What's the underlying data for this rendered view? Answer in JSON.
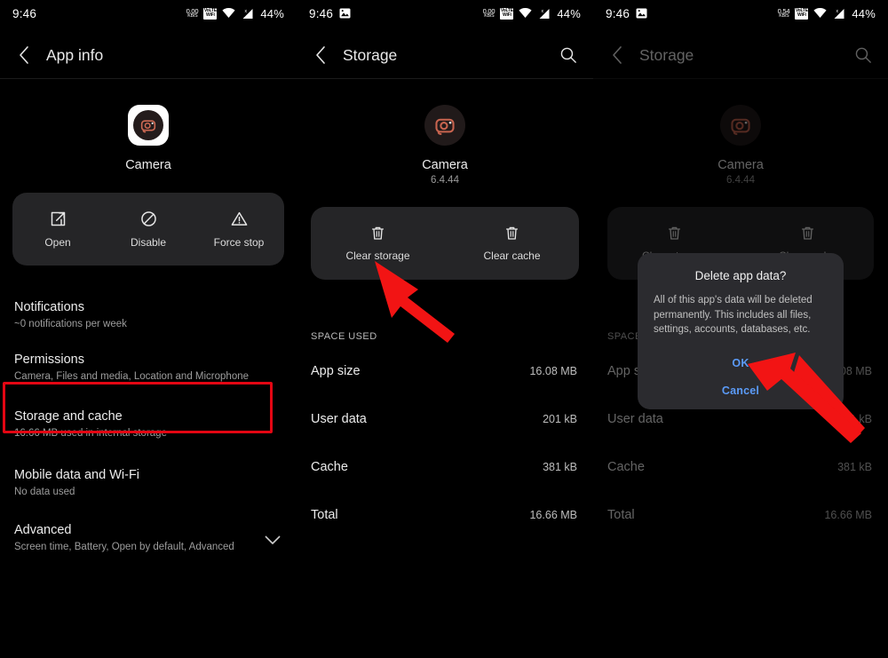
{
  "status_bar": {
    "time": "9:46",
    "data_rate_value": "0.00",
    "data_rate_unit": "KB/S",
    "data_rate_value_3": "0.54",
    "data_rate_unit_3": "KB/S",
    "vowifi_top": "VoLTE",
    "vowifi_bottom": "WiFi",
    "battery": "44%",
    "icons": [
      "image-icon",
      "data-rate-icon",
      "vowifi-icon",
      "wifi-icon",
      "cellular-signal-icon"
    ]
  },
  "panel1": {
    "appbar": {
      "title": "App info",
      "back_icon": "chevron-left-icon"
    },
    "app": {
      "name": "Camera",
      "icon": "camera-app-icon"
    },
    "actions": [
      {
        "label": "Open",
        "icon": "open-external-icon"
      },
      {
        "label": "Disable",
        "icon": "disable-icon"
      },
      {
        "label": "Force stop",
        "icon": "warning-triangle-icon"
      }
    ],
    "list": [
      {
        "title": "Notifications",
        "subtitle": "~0 notifications per week"
      },
      {
        "title": "Permissions",
        "subtitle": "Camera, Files and media, Location and Microphone"
      },
      {
        "title": "Storage and cache",
        "subtitle": "16.66 MB used in internal storage",
        "highlighted": true
      },
      {
        "title": "Mobile data and Wi-Fi",
        "subtitle": "No data used"
      },
      {
        "title": "Advanced",
        "subtitle": "Screen time, Battery, Open by default, Advanced",
        "chevron": "chevron-down-icon"
      }
    ]
  },
  "panel2": {
    "appbar": {
      "title": "Storage",
      "back_icon": "chevron-left-icon",
      "search_icon": "search-icon"
    },
    "app": {
      "name": "Camera",
      "version": "6.4.44",
      "icon": "camera-app-icon"
    },
    "actions": [
      {
        "label": "Clear storage",
        "icon": "trash-icon"
      },
      {
        "label": "Clear cache",
        "icon": "trash-icon"
      }
    ],
    "section_label": "SPACE USED",
    "rows": [
      {
        "key": "App size",
        "value": "16.08 MB"
      },
      {
        "key": "User data",
        "value": "201 kB"
      },
      {
        "key": "Cache",
        "value": "381 kB"
      },
      {
        "key": "Total",
        "value": "16.66 MB"
      }
    ]
  },
  "panel3": {
    "appbar": {
      "title": "Storage",
      "back_icon": "chevron-left-icon",
      "search_icon": "search-icon"
    },
    "app": {
      "name": "Camera",
      "version": "6.4.44",
      "icon": "camera-app-icon"
    },
    "actions": [
      {
        "label": "Clear storage",
        "icon": "trash-icon"
      },
      {
        "label": "Clear cache",
        "icon": "trash-icon"
      }
    ],
    "section_label": "SPACE USED",
    "rows": [
      {
        "key": "App size",
        "value": "16.08 MB"
      },
      {
        "key": "User data",
        "value": "201 kB"
      },
      {
        "key": "Cache",
        "value": "381 kB"
      },
      {
        "key": "Total",
        "value": "16.66 MB"
      }
    ],
    "dialog": {
      "title": "Delete app data?",
      "body": "All of this app's data will be deleted permanently. This includes all files, settings, accounts, databases, etc.",
      "ok_label": "OK",
      "cancel_label": "Cancel"
    }
  },
  "annotations": {
    "highlight_color": "#e30613",
    "arrow_color": "#f21414",
    "arrow_clear_storage_target": "Clear storage",
    "arrow_ok_target": "OK"
  }
}
